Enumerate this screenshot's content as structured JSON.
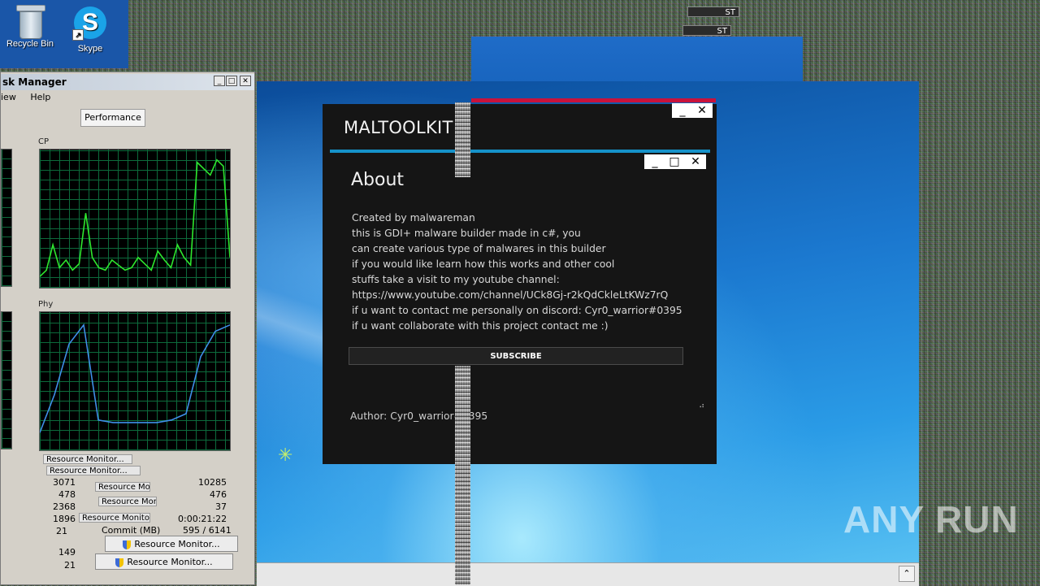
{
  "desktop": {
    "icons": [
      {
        "label": "Recycle Bin",
        "icon": "recycle-bin-icon"
      },
      {
        "label": "Skype",
        "icon": "skype-icon"
      }
    ],
    "tags": [
      "ST",
      "ST"
    ]
  },
  "task_manager": {
    "title": "sk Manager",
    "menu": [
      "iew",
      "Help"
    ],
    "tab": "Performance",
    "labels": {
      "cpu": "CP",
      "physical": "Phy"
    },
    "stack_rows": [
      "Resource Monitor...",
      "Resource Monitor...",
      "Resource Monitor...",
      "Resource Monitor...",
      "Resource Monitor..."
    ],
    "left_values": [
      "3071",
      "478",
      "2368",
      "1896",
      "21",
      "149",
      "21"
    ],
    "right_values": [
      "10285",
      "476",
      "37",
      "0:00:21:22"
    ],
    "commit_label": "Commit (MB)",
    "commit_value": "595 / 6141",
    "resource_buttons": [
      "Resource Monitor...",
      "Resource Monitor..."
    ],
    "cpu_history": [
      0.05,
      0.1,
      0.3,
      0.12,
      0.18,
      0.1,
      0.15,
      0.55,
      0.2,
      0.12,
      0.1,
      0.18,
      0.14,
      0.1,
      0.12,
      0.2,
      0.15,
      0.1,
      0.25,
      0.18,
      0.12,
      0.3,
      0.2,
      0.14,
      0.95,
      0.9,
      0.85,
      0.97,
      0.92,
      0.2
    ],
    "mem_history": [
      0.1,
      0.4,
      0.8,
      0.95,
      0.2,
      0.18,
      0.18,
      0.18,
      0.18,
      0.2,
      0.25,
      0.7,
      0.9,
      0.95
    ]
  },
  "maltoolkit": {
    "title": "MALTOOLKIT",
    "about": {
      "heading": "About",
      "lines": [
        "Created by malwareman",
        "this is GDI+ malware builder made in c#, you",
        "can create various type of malwares in this builder",
        "if you would like learn how this works and other cool",
        "stuffs take a visit to my youtube channel:",
        "https://www.youtube.com/channel/UCk8Gj-r2kQdCkleLtKWz7rQ",
        "if u want to contact me personally on discord: Cyr0_warrior#0395",
        "if u want collaborate with this project contact me :)"
      ],
      "subscribe_label": "SUBSCRIBE",
      "author": "Author: Cyr0_warrior#0395"
    },
    "colors": {
      "accent": "#1592c9",
      "stripe": "#c8123c",
      "bg": "#151515"
    }
  },
  "watermark": "ANY RUN"
}
